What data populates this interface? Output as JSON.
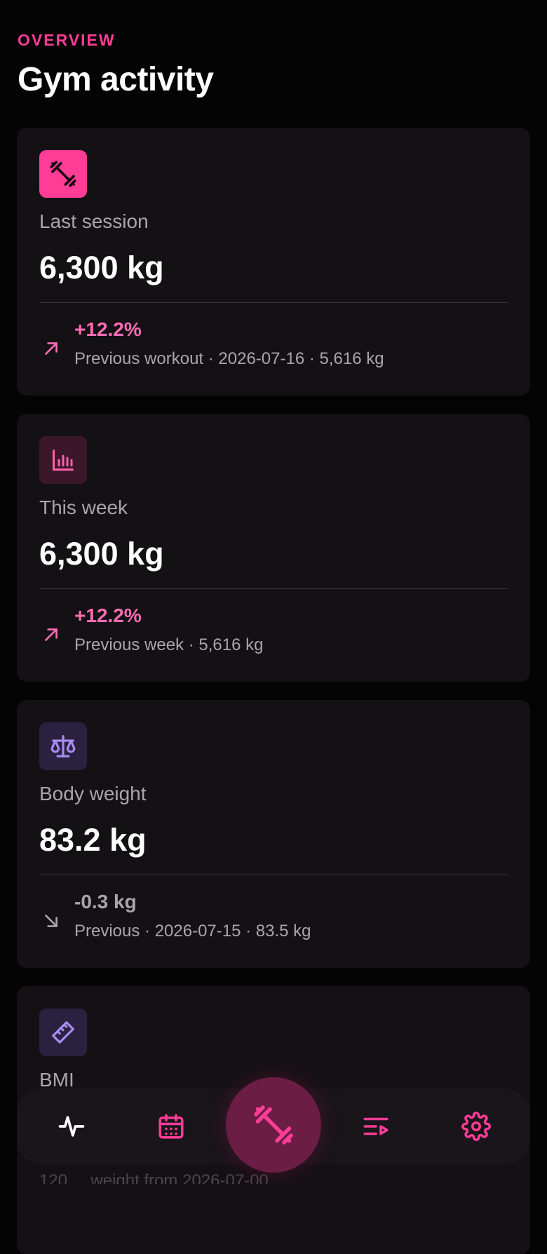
{
  "header": {
    "eyebrow": "OVERVIEW",
    "title": "Gym activity"
  },
  "colors": {
    "accent": "#ff3d97",
    "accent_soft": "#ff6cb5",
    "muted": "#a9a6aa",
    "card_bg": "#141114",
    "weight_tile": "#ff3d97",
    "week_tile": "#3b1829",
    "scale_tile": "#2a2140",
    "scale_icon": "#a88cf2"
  },
  "cards": [
    {
      "icon": "dumbbell-icon",
      "label": "Last session",
      "value": "6,300 kg",
      "trend": "up",
      "delta": "+12.2%",
      "meta": "Previous workout · 2026-07-16 · 5,616 kg"
    },
    {
      "icon": "bar-chart-icon",
      "label": "This week",
      "value": "6,300 kg",
      "trend": "up",
      "delta": "+12.2%",
      "meta": "Previous week · 5,616 kg"
    },
    {
      "icon": "scale-icon",
      "label": "Body weight",
      "value": "83.2 kg",
      "trend": "down",
      "delta": "-0.3 kg",
      "meta": "Previous · 2026-07-15 · 83.5 kg"
    },
    {
      "icon": "ruler-icon",
      "label": "BMI"
    }
  ],
  "footer_peek": "120 ... weight from 2026-07-00",
  "nav": {
    "items": [
      {
        "icon": "activity-icon"
      },
      {
        "icon": "calendar-icon"
      },
      {
        "icon": "dumbbell-icon",
        "active": true
      },
      {
        "icon": "playlist-icon"
      },
      {
        "icon": "gear-icon"
      }
    ]
  }
}
